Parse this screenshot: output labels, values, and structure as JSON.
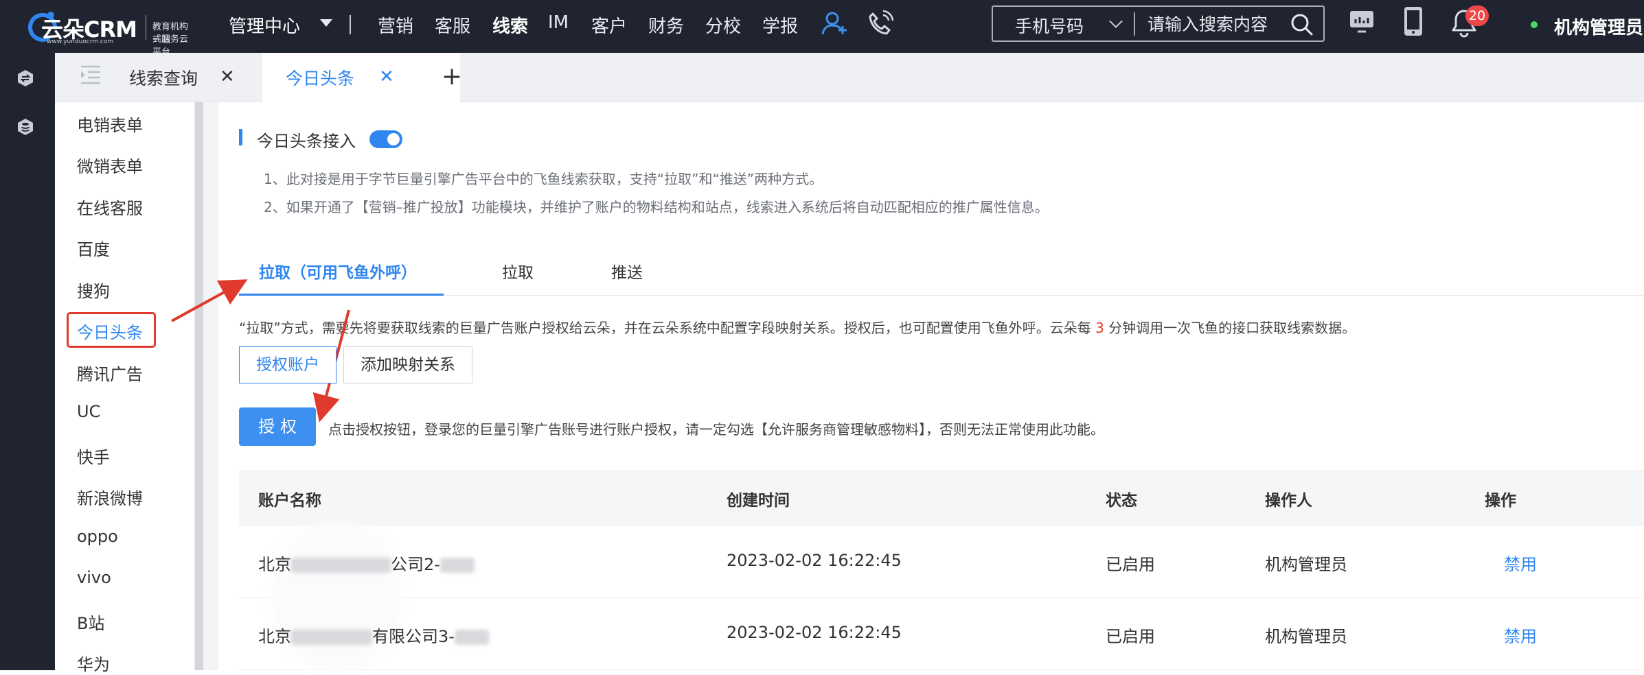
{
  "header": {
    "brand": "云朵CRM",
    "brand_url": "www.yunduocrm.com",
    "slogan_line1": "教育机构一站",
    "slogan_line2": "式服务云平台",
    "management_center": "管理中心",
    "nav": [
      "营销",
      "客服",
      "线索",
      "IM",
      "客户",
      "财务",
      "分校",
      "学报"
    ],
    "active_nav": "线索",
    "search_type": "手机号码",
    "search_placeholder": "请输入搜索内容",
    "notification_count": "20",
    "user_name": "机构管理员"
  },
  "tabs": [
    {
      "label": "线索查询",
      "close": "✕"
    },
    {
      "label": "今日头条",
      "close": "✕"
    }
  ],
  "add_tab": "+",
  "sidebar": {
    "items": [
      "电销表单",
      "微销表单",
      "在线客服",
      "百度",
      "搜狗",
      "今日头条",
      "腾讯广告",
      "UC",
      "快手",
      "新浪微博",
      "oppo",
      "vivo",
      "B站",
      "华为"
    ],
    "active": "今日头条"
  },
  "main": {
    "section_title": "今日头条接入",
    "toggle_on": true,
    "notes": [
      "1、此对接是用于字节巨量引擎广告平台中的飞鱼线索获取，支持“拉取”和“推送”两种方式。",
      "2、如果开通了【营销–推广投放】功能模块，并维护了账户的物料结构和站点，线索进入系统后将自动匹配相应的推广属性信息。"
    ],
    "method_tabs": [
      "拉取（可用飞鱼外呼）",
      "拉取",
      "推送"
    ],
    "description_before": "“拉取”方式，需要先将要获取线索的巨量广告账户授权给云朵，并在云朵系统中配置字段映射关系。授权后，也可配置使用飞鱼外呼。云朵每 ",
    "description_num": "3",
    "description_after": " 分钟调用一次飞鱼的接口获取线索数据。",
    "sub_tabs": [
      "授权账户",
      "添加映射关系"
    ],
    "auth_button": "授权",
    "auth_tip": "点击授权按钮，登录您的巨量引擎广告账号进行账户授权，请一定勾选【允许服务商管理敏感物料】，否则无法正常使用此功能。",
    "table": {
      "headers": [
        "账户名称",
        "创建时间",
        "状态",
        "操作人",
        "操作"
      ],
      "rows": [
        {
          "name_prefix": "北京",
          "name_suffix": "公司2-",
          "created": "2023-02-02 16:22:45",
          "status": "已启用",
          "operator": "机构管理员",
          "action": "禁用"
        },
        {
          "name_prefix": "北京",
          "name_suffix": "有限公司3-",
          "created": "2023-02-02 16:22:45",
          "status": "已启用",
          "operator": "机构管理员",
          "action": "禁用"
        }
      ]
    }
  },
  "colors": {
    "topbar": "#1f2430",
    "accent": "#2f86ef",
    "annotation_red": "#e03a2e"
  }
}
